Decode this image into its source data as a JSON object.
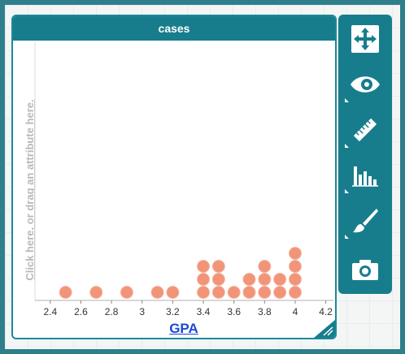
{
  "graph": {
    "title": "cases",
    "y_axis_hint": "Click here, or drag an attribute here.",
    "x_axis_label": "GPA"
  },
  "toolbar": {
    "tools": [
      {
        "icon": "move-arrows-icon"
      },
      {
        "icon": "eye-icon"
      },
      {
        "icon": "ruler-icon"
      },
      {
        "icon": "bar-chart-icon"
      },
      {
        "icon": "paintbrush-icon"
      },
      {
        "icon": "camera-icon"
      }
    ]
  },
  "colors": {
    "accent": "#177d8d",
    "dot_fill": "#f29478",
    "dot_stroke": "#f5b7a4",
    "axis_link": "#1a49d6"
  },
  "chart_data": {
    "type": "scatter",
    "title": "",
    "xlabel": "GPA",
    "ylabel": "",
    "xlim": [
      2.3,
      4.25
    ],
    "xticks": [
      2.4,
      2.6,
      2.8,
      3,
      3.2,
      3.4,
      3.6,
      3.8,
      4,
      4.2
    ],
    "xtick_labels": [
      "2.4",
      "2.6",
      "2.8",
      "3",
      "3.2",
      "3.4",
      "3.6",
      "3.8",
      "4",
      "4.2"
    ],
    "stacked_points": [
      {
        "x": 2.5,
        "count": 1
      },
      {
        "x": 2.7,
        "count": 1
      },
      {
        "x": 2.9,
        "count": 1
      },
      {
        "x": 3.1,
        "count": 1
      },
      {
        "x": 3.2,
        "count": 1
      },
      {
        "x": 3.4,
        "count": 3
      },
      {
        "x": 3.5,
        "count": 3
      },
      {
        "x": 3.6,
        "count": 1
      },
      {
        "x": 3.7,
        "count": 2
      },
      {
        "x": 3.8,
        "count": 3
      },
      {
        "x": 3.9,
        "count": 2
      },
      {
        "x": 4.0,
        "count": 4
      }
    ]
  }
}
